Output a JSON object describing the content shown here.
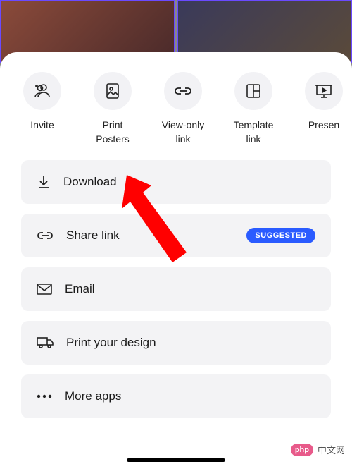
{
  "top_actions": [
    {
      "label": "Invite",
      "icon": "invite-icon"
    },
    {
      "label": "Print\nPosters",
      "icon": "print-icon"
    },
    {
      "label": "View-only\nlink",
      "icon": "link-icon"
    },
    {
      "label": "Template\nlink",
      "icon": "template-icon"
    },
    {
      "label": "Presen",
      "icon": "present-icon"
    }
  ],
  "list": {
    "download": {
      "label": "Download"
    },
    "share_link": {
      "label": "Share link",
      "badge": "SUGGESTED"
    },
    "email": {
      "label": "Email"
    },
    "print_design": {
      "label": "Print your design"
    },
    "more_apps": {
      "label": "More apps"
    }
  },
  "watermark": {
    "php": "php",
    "text": "中文网"
  }
}
